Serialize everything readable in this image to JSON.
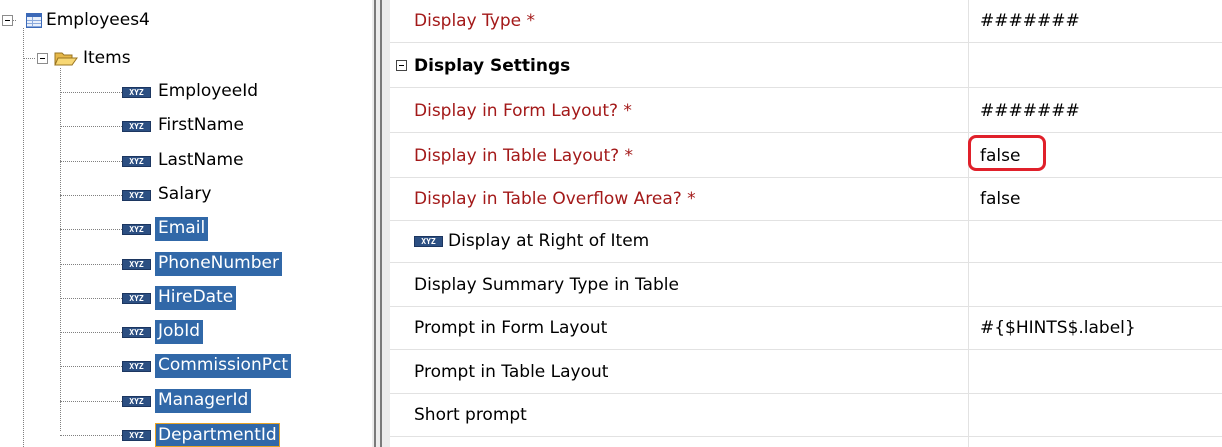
{
  "tree": {
    "root_label": "Employees4",
    "folder_label": "Items",
    "items": [
      {
        "label": "EmployeeId",
        "selected": false
      },
      {
        "label": "FirstName",
        "selected": false
      },
      {
        "label": "LastName",
        "selected": false
      },
      {
        "label": "Salary",
        "selected": false
      },
      {
        "label": "Email",
        "selected": true
      },
      {
        "label": "PhoneNumber",
        "selected": true
      },
      {
        "label": "HireDate",
        "selected": true
      },
      {
        "label": "JobId",
        "selected": true
      },
      {
        "label": "CommissionPct",
        "selected": true
      },
      {
        "label": "ManagerId",
        "selected": true
      },
      {
        "label": "DepartmentId",
        "selected": true,
        "focused": true
      }
    ],
    "item_icon_text": "XYZ",
    "selection_color": "#3168a8",
    "focus_color": "#e8a427"
  },
  "properties": {
    "rows": [
      {
        "name": "Display Type *",
        "value": "#######",
        "required": true
      },
      {
        "name": "Display Settings",
        "value": "",
        "category": true
      },
      {
        "name": "Display in Form Layout? *",
        "value": "#######",
        "required": true
      },
      {
        "name": "Display in Table Layout? *",
        "value": "false",
        "required": true,
        "highlighted": true
      },
      {
        "name": "Display in Table Overflow Area? *",
        "value": "false",
        "required": true
      },
      {
        "name": "Display at Right of Item",
        "value": "",
        "icon": "xyz-icon"
      },
      {
        "name": "Display Summary Type in Table",
        "value": ""
      },
      {
        "name": "Prompt in Form Layout",
        "value": "#{$HINTS$.label}"
      },
      {
        "name": "Prompt in Table Layout",
        "value": ""
      },
      {
        "name": "Short prompt",
        "value": ""
      }
    ],
    "required_color": "#a31919",
    "highlight_color": "#e0202a"
  }
}
